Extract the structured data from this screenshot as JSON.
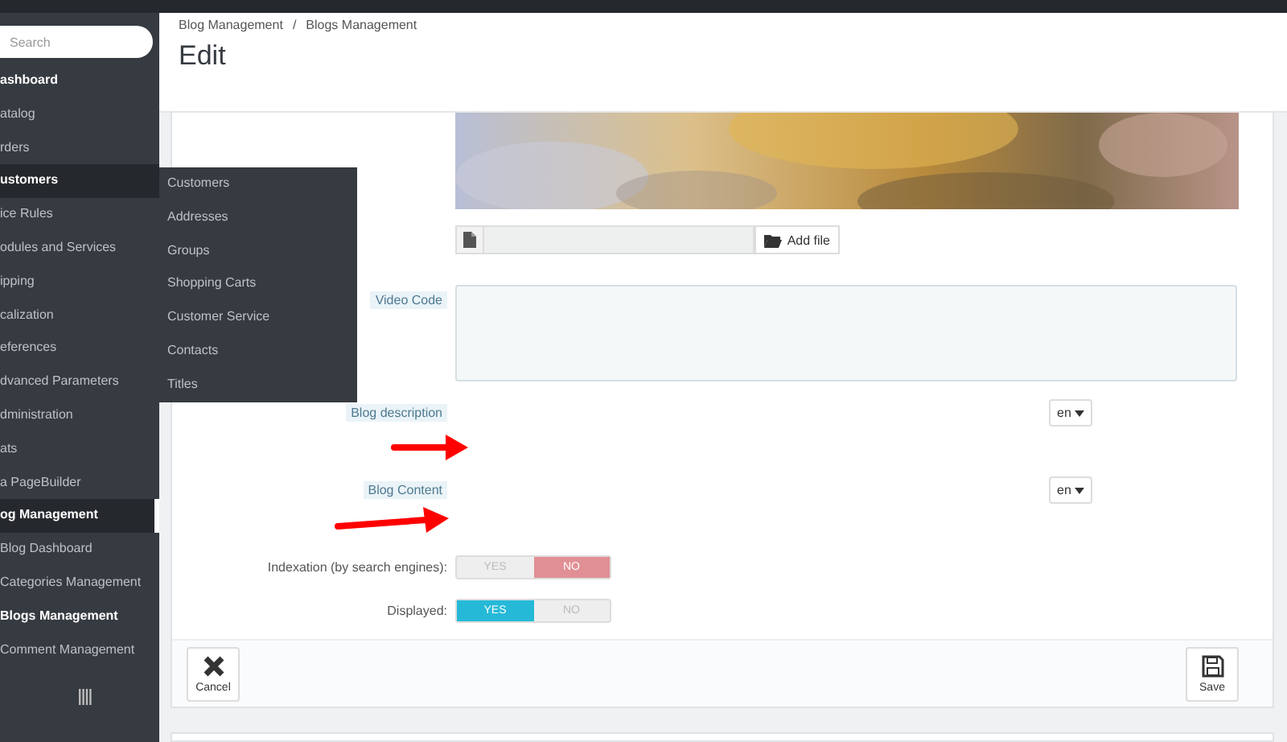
{
  "sidebar": {
    "search": {
      "placeholder": "Search"
    },
    "items": [
      {
        "label": "ashboard",
        "active": true
      },
      {
        "label": "atalog",
        "active": false
      },
      {
        "label": "rders",
        "active": false
      },
      {
        "label": "ustomers",
        "active": true,
        "hovered": true
      },
      {
        "label": "ice Rules",
        "active": false
      },
      {
        "label": "odules and Services",
        "active": false
      },
      {
        "label": "ipping",
        "active": false
      },
      {
        "label": "calization",
        "active": false
      },
      {
        "label": "eferences",
        "active": false
      },
      {
        "label": "dvanced Parameters",
        "active": false
      },
      {
        "label": "dministration",
        "active": false
      },
      {
        "label": "ats",
        "active": false
      },
      {
        "label": "a PageBuilder",
        "active": false
      },
      {
        "label": "og Management",
        "active": true,
        "expanded": true,
        "children": [
          {
            "label": "Blog Dashboard",
            "selected": false
          },
          {
            "label": "Categories Management",
            "selected": false
          },
          {
            "label": "Blogs Management",
            "selected": true
          },
          {
            "label": "Comment Management",
            "selected": false
          }
        ]
      }
    ]
  },
  "flyout": {
    "items": [
      "Customers",
      "Addresses",
      "Groups",
      "Shopping Carts",
      "Customer Service",
      "Contacts",
      "Titles"
    ]
  },
  "header": {
    "breadcrumb": [
      "Blog Management",
      "Blogs Management"
    ],
    "breadcrumb_separator": "/",
    "title": "Edit"
  },
  "form": {
    "file_button": "Add file",
    "fields": [
      {
        "kind": "textarea",
        "label": "Video Code"
      },
      {
        "kind": "multilang",
        "label": "Blog description",
        "language": "en",
        "annotated": true
      },
      {
        "kind": "multilang",
        "label": "Blog Content",
        "language": "en",
        "annotated": true
      },
      {
        "kind": "switch",
        "label": "Indexation (by search engines):",
        "on": false,
        "yes": "YES",
        "no": "NO"
      },
      {
        "kind": "switch",
        "label": "Displayed:",
        "on": true,
        "yes": "YES",
        "no": "NO"
      }
    ],
    "buttons": [
      {
        "kind": "cancel",
        "label": "Cancel"
      },
      {
        "kind": "save",
        "label": "Save"
      }
    ]
  }
}
